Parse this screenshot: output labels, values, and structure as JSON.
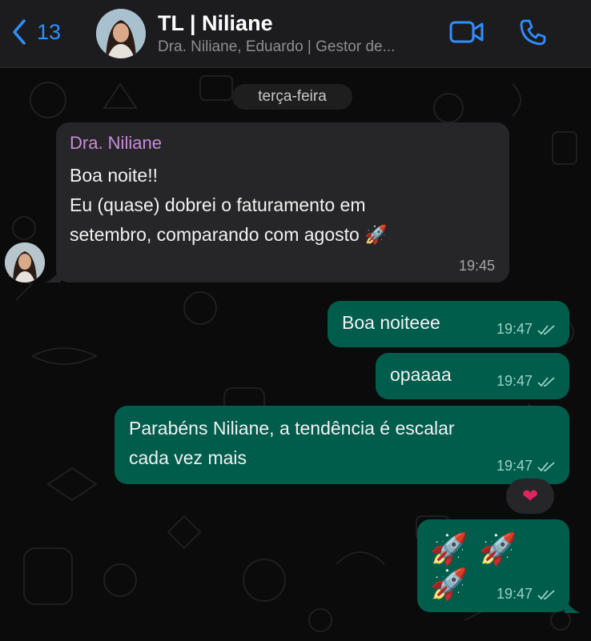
{
  "header": {
    "back_count": "13",
    "title": "TL | Niliane",
    "subtitle": "Dra. Niliane, Eduardo | Gestor de..."
  },
  "chat": {
    "day_label": "terça-feira",
    "incoming": {
      "sender": "Dra. Niliane",
      "text": "Boa noite!!\nEu (quase) dobrei o faturamento em\nsetembro, comparando com agosto 🚀",
      "time": "19:45"
    },
    "outgoing": [
      {
        "text": "Boa noiteee",
        "time": "19:47"
      },
      {
        "text": "opaaaa",
        "time": "19:47"
      },
      {
        "text": "Parabéns Niliane, a tendência é escalar\ncada vez mais",
        "time": "19:47",
        "reaction": "❤"
      },
      {
        "text": "🚀🚀🚀",
        "time": "19:47"
      }
    ]
  },
  "colors": {
    "accent": "#2f8fff",
    "outgoing_bubble": "#005c4b",
    "incoming_bubble": "#262628",
    "sender_name": "#c98bdc"
  },
  "icons": [
    "chevron-left-icon",
    "video-call-icon",
    "phone-icon",
    "double-check-icon",
    "rocket-emoji",
    "heart-reaction"
  ]
}
